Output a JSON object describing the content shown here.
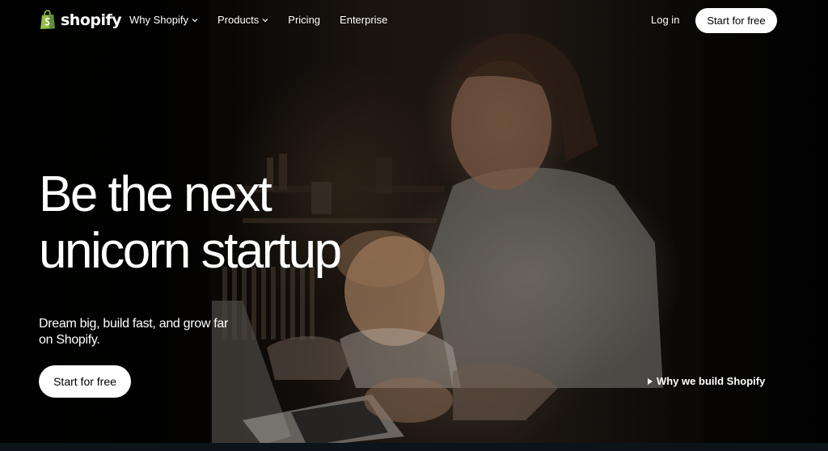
{
  "brand": {
    "name": "shopify",
    "logo_icon": "shopping-bag-icon",
    "accent_color": "#95BF47"
  },
  "nav": {
    "items": [
      {
        "label": "Why Shopify",
        "has_dropdown": true
      },
      {
        "label": "Products",
        "has_dropdown": true
      },
      {
        "label": "Pricing",
        "has_dropdown": false
      },
      {
        "label": "Enterprise",
        "has_dropdown": false
      }
    ],
    "login_label": "Log in",
    "cta_label": "Start for free"
  },
  "hero": {
    "title_line1": "Be the next",
    "title_line2": "unicorn startup",
    "subtitle": "Dream big, build fast, and grow far on Shopify.",
    "cta_label": "Start for free",
    "video_link_label": "Why we build Shopify",
    "video_link_icon": "play-icon"
  },
  "colors": {
    "background": "#000000",
    "text": "#FFFFFF",
    "button_bg": "#FFFFFF",
    "button_text": "#000000"
  }
}
